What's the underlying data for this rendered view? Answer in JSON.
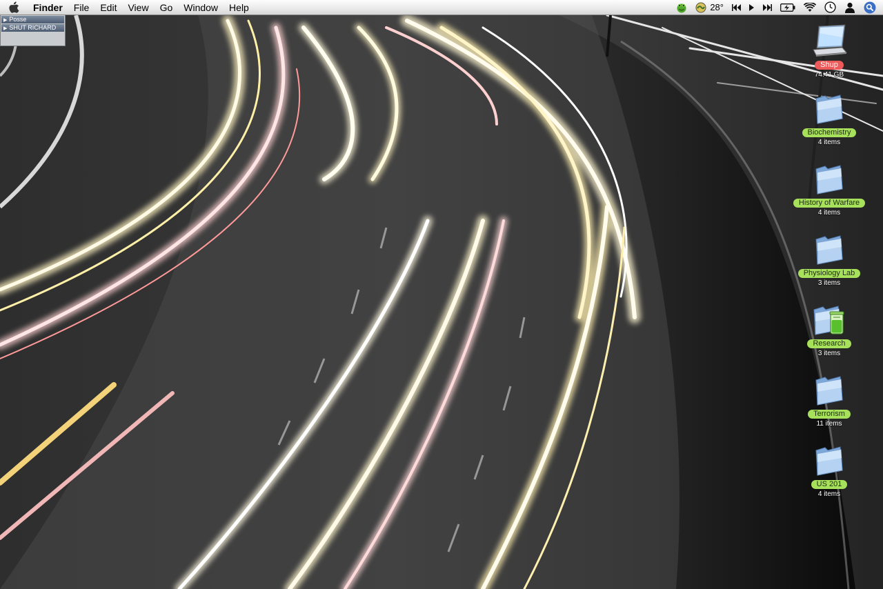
{
  "menubar": {
    "app_name": "Finder",
    "menus": [
      "File",
      "Edit",
      "View",
      "Go",
      "Window",
      "Help"
    ],
    "weather_temp": "28°"
  },
  "drawer": {
    "items": [
      "Posse",
      "SHUT RICHARD"
    ]
  },
  "desktop_icons": [
    {
      "label": "Shup",
      "info": "74.41 GB",
      "kind": "laptop-drive",
      "label_color": "#ec5a5a"
    },
    {
      "label": "Biochemistry",
      "info": "4 items",
      "kind": "folder",
      "label_color": "#a7e05b"
    },
    {
      "label": "History of Warfare",
      "info": "4 items",
      "kind": "folder",
      "label_color": "#a7e05b"
    },
    {
      "label": "Physiology Lab",
      "info": "3 items",
      "kind": "folder",
      "label_color": "#a7e05b"
    },
    {
      "label": "Research",
      "info": "3 items",
      "kind": "folder-with-flask",
      "label_color": "#a7e05b"
    },
    {
      "label": "Terrorism",
      "info": "11 items",
      "kind": "folder",
      "label_color": "#a7e05b"
    },
    {
      "label": "US 201",
      "info": "4 items",
      "kind": "folder",
      "label_color": "#a7e05b"
    }
  ],
  "colors": {
    "label_green": "#a7e05b",
    "label_red": "#ec5a5a",
    "menubar_bg": "#ececec"
  }
}
